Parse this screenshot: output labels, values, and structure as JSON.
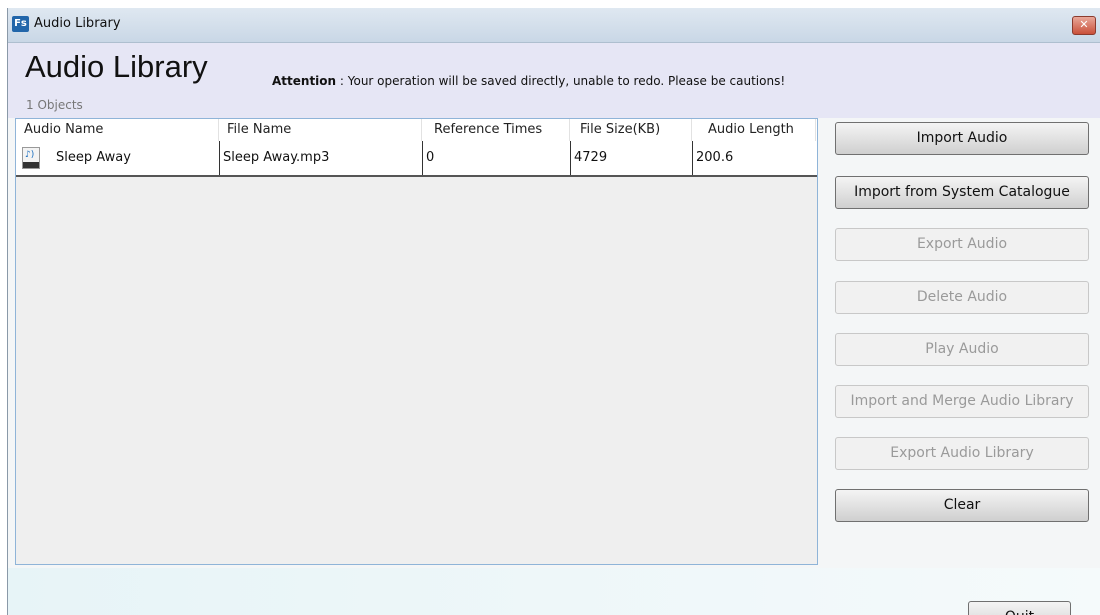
{
  "window": {
    "title": "Audio Library",
    "app_icon_text": "Fs",
    "close_glyph": "✕"
  },
  "header": {
    "title": "Audio Library",
    "attention_label": "Attention",
    "attention_text": " : Your operation will be saved directly, unable to redo. Please be cautions!",
    "count_text": "1 Objects"
  },
  "table": {
    "columns": [
      "Audio Name",
      "File Name",
      "Reference Times",
      "File Size(KB)",
      "Audio Length"
    ],
    "rows": [
      {
        "icon": "audio-file-icon",
        "audio_name": "Sleep Away",
        "file_name": "Sleep Away.mp3",
        "reference_times": "0",
        "file_size": "4729",
        "audio_length": "200.6"
      }
    ]
  },
  "buttons": {
    "import_audio": "Import Audio",
    "import_system": "Import from System Catalogue",
    "export_audio": "Export Audio",
    "delete_audio": "Delete Audio",
    "play_audio": "Play Audio",
    "import_merge": "Import and Merge Audio Library",
    "export_library": "Export Audio Library",
    "clear": "Clear",
    "quit": "Quit"
  },
  "colors": {
    "header_bg": "#e6e6f5",
    "table_border": "#8fb4d8",
    "close_button": "#c9503a"
  }
}
